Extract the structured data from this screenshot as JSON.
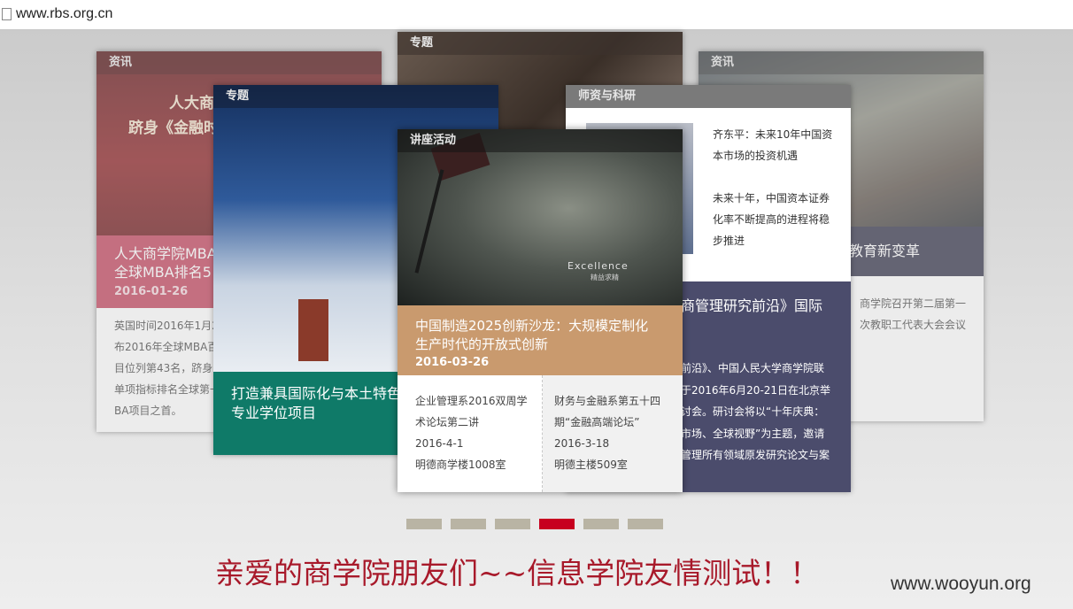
{
  "browser": {
    "url": "www.rbs.org.cn"
  },
  "cards": {
    "news": {
      "header": "资讯",
      "image_text_1": "人大商",
      "image_text_2": "跻身《金融时",
      "title": "人大商学院MBA\n全球MBA排名5",
      "date": "2016-01-26",
      "body": "英国时间2016年1月2\n布2016年全球MBA百\n目位列第43名，跻身\n单项指标排名全球第一\nBA项目之首。"
    },
    "topic_back": {
      "header": "专题"
    },
    "topic_front": {
      "header": "专题",
      "title": "打造兼具国际化与本土特色\n专业学位项目"
    },
    "news_right": {
      "header": "资讯",
      "title": "教育新变革",
      "body": "商学院召开第二届第一\n次教职工代表大会会议"
    },
    "faculty": {
      "header": "师资与科研",
      "side_text": "齐东平：未来10年中国资\n本市场的投资机遇\n\n未来十年，中国资本证券\n化率不断提高的进程将稳\n步推进",
      "purple_title": "商管理研究前沿》国际",
      "purple_body": "前沿》、中国人民大学商学院联\n于2016年6月20-21日在北京举\n讨会。研讨会将以“十年庆典：\n市场、全球视野”为主题，邀请\n管理所有领域原发研究论文与案"
    },
    "lecture": {
      "header": "讲座活动",
      "image_caption": "Excellence",
      "image_caption_sub": "精益求精",
      "title": "中国制造2025创新沙龙：大规模定制化\n生产时代的开放式创新",
      "date": "2016-03-26",
      "events": [
        {
          "title": "企业管理系2016双周学\n术论坛第二讲",
          "date": "2016-4-1",
          "place": "明德商学楼1008室"
        },
        {
          "title": "财务与金融系第五十四\n期“金融高端论坛”",
          "date": "2016-3-18",
          "place": "明德主楼509室"
        }
      ]
    }
  },
  "pagination": {
    "count": 6,
    "active_index": 3
  },
  "slogan": "亲爱的商学院朋友们~~信息学院友情测试！！",
  "watermark": "www.wooyun.org",
  "colors": {
    "red": "#c7001f",
    "slogan": "#a8192a",
    "lecture_band": "#c99a6e",
    "topic_band": "#0f7a68",
    "faculty_purple": "#4b4c6c"
  }
}
